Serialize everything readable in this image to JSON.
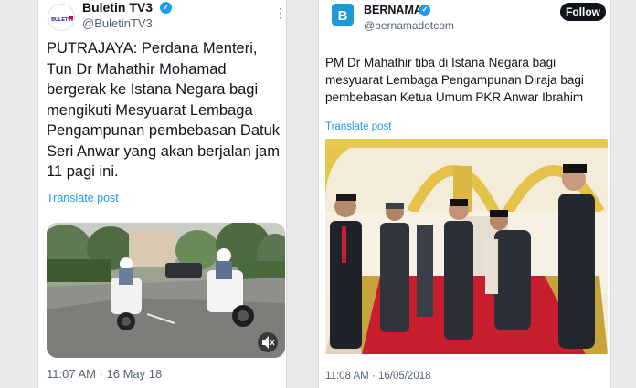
{
  "tweet1": {
    "display_name": "Buletin TV3",
    "handle": "@BuletinTV3",
    "avatar_logo_text": "BULETIN",
    "verified_icon": "check-badge-icon",
    "more_icon": "more-dots-icon",
    "body": "PUTRAJAYA: Perdana Menteri, Tun Dr Mahathir Mohamad bergerak ke Istana Negara bagi mengikuti Mesyuarat Lembaga Pengampunan pembebasan Datuk Seri Anwar yang akan berjalan jam 11 pagi ini.",
    "translate_label": "Translate post",
    "timestamp": "11:07 AM · 16 May 18",
    "mute_icon": "speaker-mute-icon"
  },
  "tweet2": {
    "display_name": "BERNAMA",
    "handle": "@bernamadotcom",
    "avatar_logo_text": "B",
    "verified_icon": "check-badge-icon",
    "follow_label": "Follow",
    "body": "PM Dr Mahathir tiba di Istana Negara bagi mesyuarat Lembaga Pengampunan Diraja bagi pembebasan Ketua Umum PKR Anwar Ibrahim",
    "translate_label": "Translate post",
    "timestamp": "11:08 AM · 16/05/2018"
  },
  "colors": {
    "link": "#1d9bf0",
    "secondary_text": "#536471",
    "bernama_brand": "#1c9ad6",
    "tv3_brand": "#e4002b"
  }
}
